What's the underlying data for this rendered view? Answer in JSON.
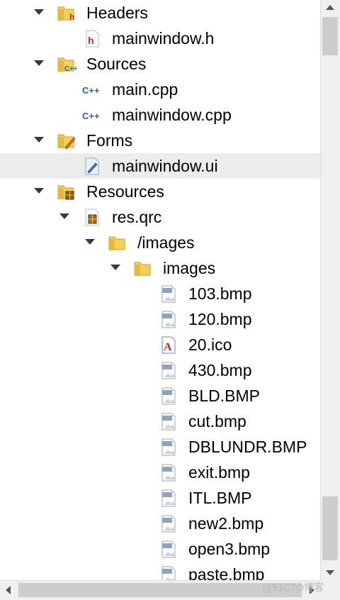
{
  "tree": {
    "items": [
      {
        "label": "Headers",
        "icon": "folder-header-icon",
        "expanded": true
      },
      {
        "label": "mainwindow.h",
        "icon": "header-file-icon"
      },
      {
        "label": "Sources",
        "icon": "folder-source-icon",
        "expanded": true
      },
      {
        "label": "main.cpp",
        "icon": "cpp-file-icon"
      },
      {
        "label": "mainwindow.cpp",
        "icon": "cpp-file-icon"
      },
      {
        "label": "Forms",
        "icon": "folder-forms-icon",
        "expanded": true
      },
      {
        "label": "mainwindow.ui",
        "icon": "ui-file-icon",
        "selected": true
      },
      {
        "label": "Resources",
        "icon": "folder-resources-icon",
        "expanded": true
      },
      {
        "label": "res.qrc",
        "icon": "qrc-file-icon",
        "expanded": true
      },
      {
        "label": "/images",
        "icon": "folder-icon",
        "expanded": true
      },
      {
        "label": "images",
        "icon": "folder-icon",
        "expanded": true
      },
      {
        "label": "103.bmp",
        "icon": "bmp-file-icon"
      },
      {
        "label": "120.bmp",
        "icon": "bmp-file-icon"
      },
      {
        "label": "20.ico",
        "icon": "ico-file-icon"
      },
      {
        "label": "430.bmp",
        "icon": "bmp-file-icon"
      },
      {
        "label": "BLD.BMP",
        "icon": "bmp-file-icon"
      },
      {
        "label": "cut.bmp",
        "icon": "bmp-file-icon"
      },
      {
        "label": "DBLUNDR.BMP",
        "icon": "bmp-file-icon"
      },
      {
        "label": "exit.bmp",
        "icon": "bmp-file-icon"
      },
      {
        "label": "ITL.BMP",
        "icon": "bmp-file-icon"
      },
      {
        "label": "new2.bmp",
        "icon": "bmp-file-icon"
      },
      {
        "label": "open3.bmp",
        "icon": "bmp-file-icon"
      },
      {
        "label": "paste.bmp",
        "icon": "bmp-file-icon"
      }
    ]
  },
  "watermark": "@51CTO博客",
  "colors": {
    "selected_row": "#ececec",
    "folder": "#f2c94c",
    "header_h": "#c0262d",
    "cpp": "#2a5fa8"
  }
}
